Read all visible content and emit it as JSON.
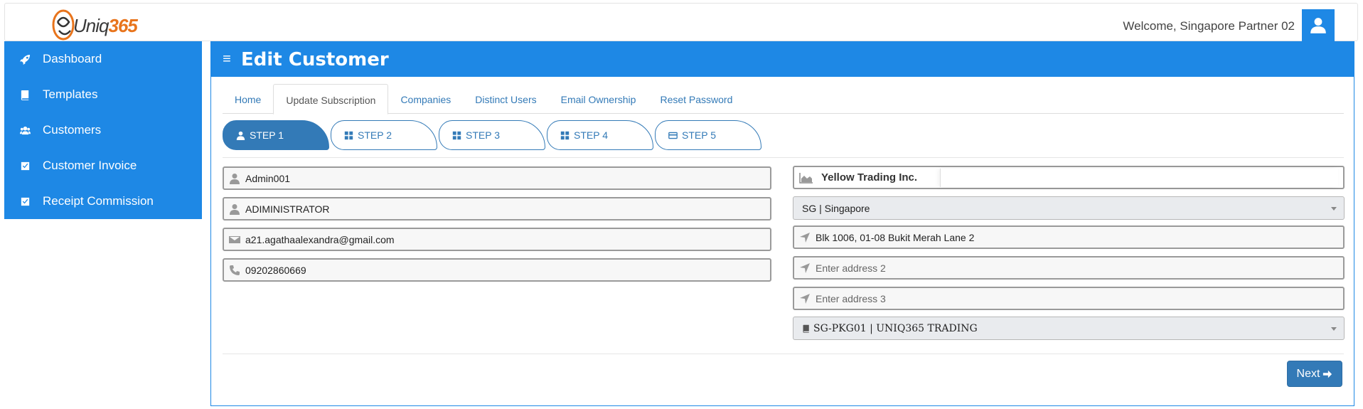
{
  "header": {
    "logo_text_a": "Uniq",
    "logo_text_b": "365",
    "welcome": "Welcome, Singapore Partner 02"
  },
  "sidebar": {
    "items": [
      {
        "label": "Dashboard",
        "icon": "rocket-icon"
      },
      {
        "label": "Templates",
        "icon": "book-icon"
      },
      {
        "label": "Customers",
        "icon": "users-icon"
      },
      {
        "label": "Customer Invoice",
        "icon": "check-square-icon"
      },
      {
        "label": "Receipt Commission",
        "icon": "check-square-icon"
      }
    ]
  },
  "main": {
    "title": "Edit Customer",
    "tabs": [
      {
        "label": "Home"
      },
      {
        "label": "Update Subscription",
        "active": true
      },
      {
        "label": "Companies"
      },
      {
        "label": "Distinct Users"
      },
      {
        "label": "Email Ownership"
      },
      {
        "label": "Reset Password"
      }
    ],
    "steps": [
      {
        "label": "STEP 1",
        "icon": "user-icon",
        "active": true
      },
      {
        "label": "STEP 2",
        "icon": "grid-icon"
      },
      {
        "label": "STEP 3",
        "icon": "grid-icon"
      },
      {
        "label": "STEP 4",
        "icon": "grid-icon"
      },
      {
        "label": "STEP 5",
        "icon": "credit-card-icon"
      }
    ]
  },
  "form": {
    "username": "Admin001",
    "fullname": "ADIMINISTRATOR",
    "email": "a21.agathaalexandra@gmail.com",
    "phone": "09202860669",
    "company": "Yellow Trading Inc.",
    "country": "SG | Singapore",
    "address1": "Blk 1006, 01-08 Bukit Merah Lane 2",
    "address2_placeholder": "Enter address 2",
    "address3_placeholder": "Enter address 3",
    "package": "SG-PKG01 | UNIQ365 TRADING"
  },
  "actions": {
    "next_label": "Next"
  },
  "colors": {
    "primary": "#1e88e5",
    "button": "#337ab7",
    "logo_orange": "#e8741c"
  }
}
